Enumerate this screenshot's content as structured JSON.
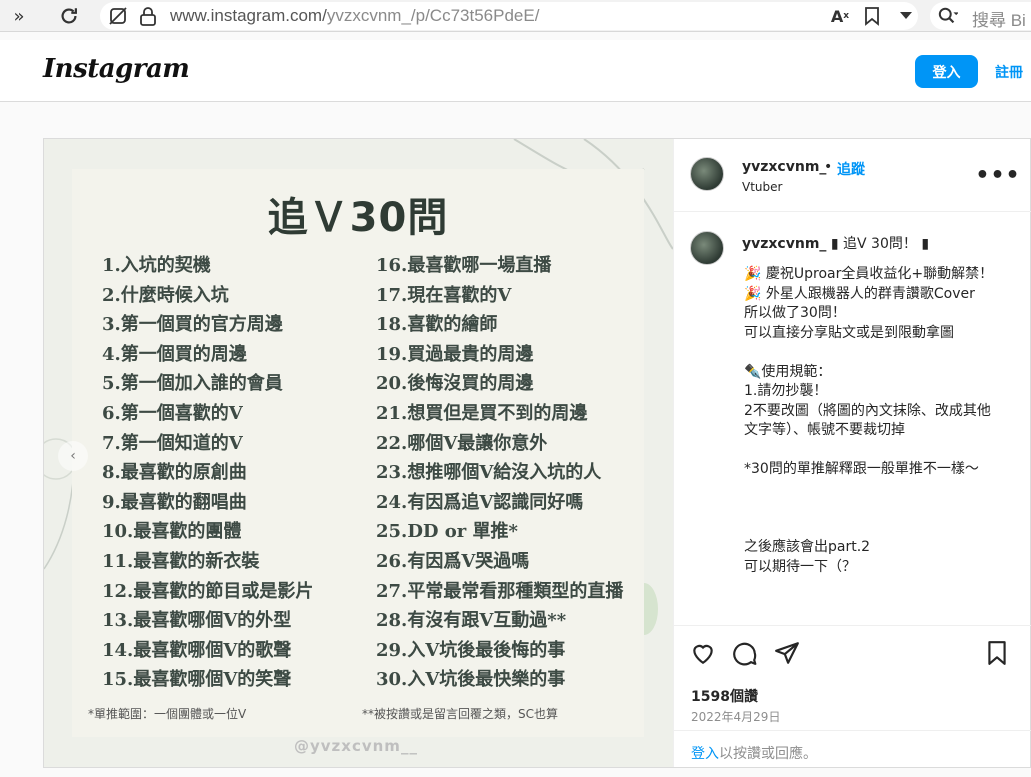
{
  "browser": {
    "url_domain": "www.instagram.com/",
    "url_path": "yvzxcvnm_/p/Cc73t56PdeE/",
    "search_placeholder": "搜尋 Bi"
  },
  "header": {
    "logo": "Instagram",
    "login_label": "登入",
    "signup_label": "註冊"
  },
  "poster": {
    "title": "追Ｖ30問",
    "questions_left": [
      "1.入坑的契機",
      "2.什麼時候入坑",
      "3.第一個買的官方周邊",
      "4.第一個買的周邊",
      "5.第一個加入誰的會員",
      "6.第一個喜歡的V",
      "7.第一個知道的V",
      "8.最喜歡的原創曲",
      "9.最喜歡的翻唱曲",
      "10.最喜歡的團體",
      "11.最喜歡的新衣裝",
      "12.最喜歡的節目或是影片",
      "13.最喜歡哪個V的外型",
      "14.最喜歡哪個V的歌聲",
      "15.最喜歡哪個V的笑聲"
    ],
    "questions_right": [
      "16.最喜歡哪一場直播",
      "17.現在喜歡的V",
      "18.喜歡的繪師",
      "19.買過最貴的周邊",
      "20.後悔沒買的周邊",
      "21.想買但是買不到的周邊",
      "22.哪個V最讓你意外",
      "23.想推哪個V給沒入坑的人",
      "24.有因爲追V認識同好嗎",
      "25.DD or 單推*",
      "26.有因爲V哭過嗎",
      "27.平常最常看那種類型的直播",
      "28.有沒有跟V互動過**",
      "29.入V坑後最後悔的事",
      "30.入V坑後最快樂的事"
    ],
    "note_left": "*單推範圍：一個團體或一位V",
    "note_right": "**被按讚或是留言回覆之類，SC也算",
    "watermark": "@yvzxcvnm__"
  },
  "post": {
    "username": "yvzxcvnm_",
    "dot": "•",
    "follow_label": "追蹤",
    "subtitle": "Vtuber",
    "caption_username": "yvzxcvnm_",
    "caption_first_line": "▮ 追V 30問！ ▮",
    "caption_body": "🎉 慶祝Uproar全員收益化+聯動解禁！\n🎉 外星人跟機器人的群青讚歌Cover\n所以做了30問！\n可以直接分享貼文或是到限動拿圖\n\n✒️使用規範：\n1.請勿抄襲！\n2不要改圖（將圖的內文抹除、改成其他文字等）、帳號不要裁切掉\n\n*30問的單推解釋跟一般單推不一樣～\n\n\n\n之後應該會出part.2\n可以期待一下（？",
    "likes": "1598個讚",
    "date": "2022年4月29日",
    "login_link": "登入",
    "login_rest": "以按讚或回應。"
  }
}
